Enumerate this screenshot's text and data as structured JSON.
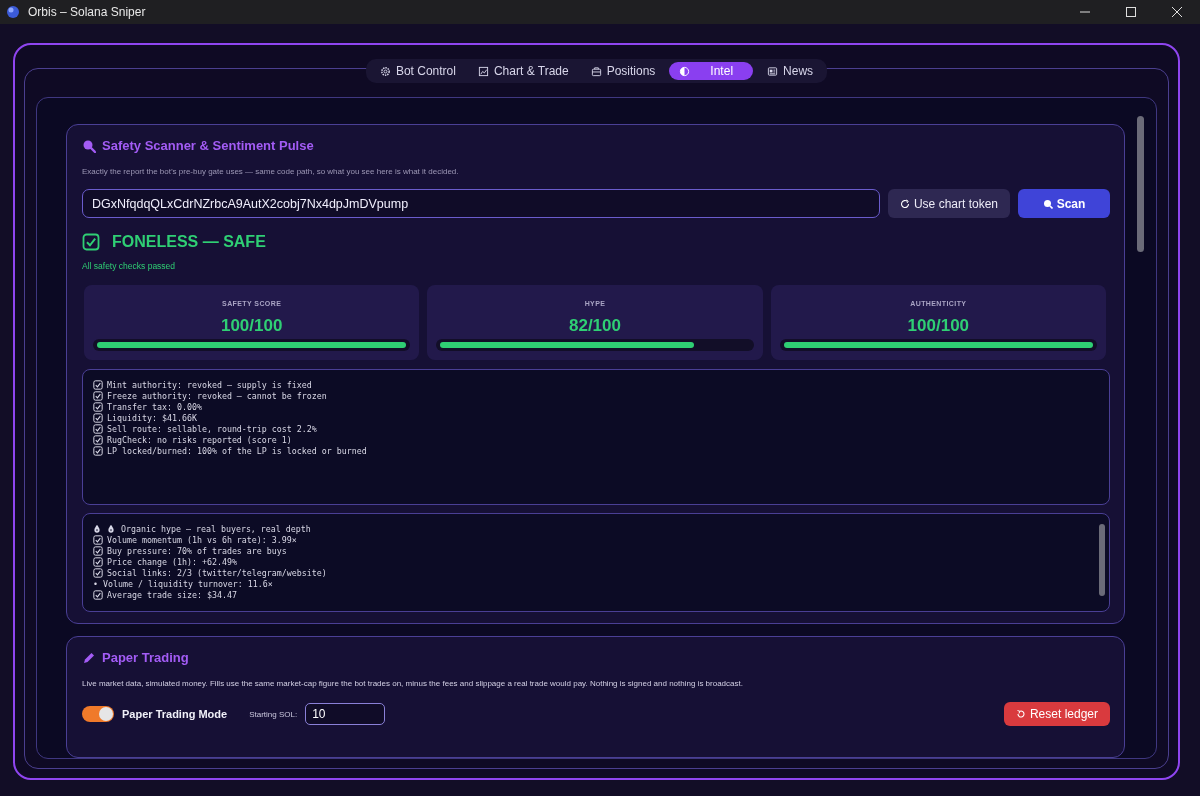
{
  "window": {
    "title": "Orbis – Solana Sniper"
  },
  "tabs": [
    {
      "label": "Bot Control",
      "kind": "control",
      "selected": false
    },
    {
      "label": "Chart & Trade",
      "kind": "chart",
      "selected": false
    },
    {
      "label": "Positions",
      "kind": "positions",
      "selected": false
    },
    {
      "label": "Intel",
      "kind": "intel",
      "selected": true
    },
    {
      "label": "News",
      "kind": "news",
      "selected": false
    }
  ],
  "scanner": {
    "title": "Safety Scanner & Sentiment Pulse",
    "subtitle": "Exactly the report the bot’s pre-buy gate uses — same code path, so what you see here is what it decided.",
    "token": "DGxNfqdqQLxCdrNZrbcA9AutX2cobj7Nx4dpJmDVpump",
    "chart_button": "Use chart token",
    "scan_button": "Scan",
    "verdict": {
      "text": "FONELESS — SAFE",
      "safe": true,
      "note": "All safety checks passed"
    },
    "scores": [
      {
        "label": "SAFETY SCORE",
        "value": "100/100",
        "level": 1
      },
      {
        "label": "HYPE",
        "value": "82/100",
        "level": 0.82
      },
      {
        "label": "AUTHENTICITY",
        "value": "100/100",
        "level": 1
      }
    ],
    "checks": [
      {
        "text": "Mint authority: revoked — supply is fixed",
        "checked": true
      },
      {
        "text": "Freeze authority: revoked — cannot be frozen",
        "checked": true
      },
      {
        "text": "Transfer tax: 0.00%",
        "checked": true
      },
      {
        "text": "Liquidity: $41.66K",
        "checked": true
      },
      {
        "text": "Sell route: sellable, round-trip cost 2.2%",
        "checked": true
      },
      {
        "text": "RugCheck: no risks reported (score 1)",
        "checked": true
      },
      {
        "text": "LP locked/burned: 100% of the LP is locked or burned",
        "checked": true
      }
    ],
    "pulse": [
      {
        "kind": "hype",
        "text": "Organic hype — real buyers, real depth"
      },
      {
        "kind": "check",
        "text": "Volume momentum (1h vs 6h rate): 3.99×"
      },
      {
        "kind": "check",
        "text": "Buy pressure: 70% of trades are buys"
      },
      {
        "kind": "check",
        "text": "Price change (1h): +62.49%"
      },
      {
        "kind": "check",
        "text": "Social links: 2/3 (twitter/telegram/website)"
      },
      {
        "kind": "bullet",
        "text": "• Volume / liquidity turnover: 11.6×"
      },
      {
        "kind": "check",
        "text": "Average trade size: $34.47"
      }
    ]
  },
  "paper": {
    "title": "Paper Trading",
    "description": "Live market data, simulated money. Fills use the same market-cap figure the bot trades on, minus the fees and slippage a real trade would pay. Nothing is signed and nothing is broadcast.",
    "mode": {
      "label": "Paper Trading Mode",
      "on": true
    },
    "starting_sol": {
      "label": "Starting SOL:",
      "value": "10"
    },
    "reset_button": "Reset ledger"
  }
}
